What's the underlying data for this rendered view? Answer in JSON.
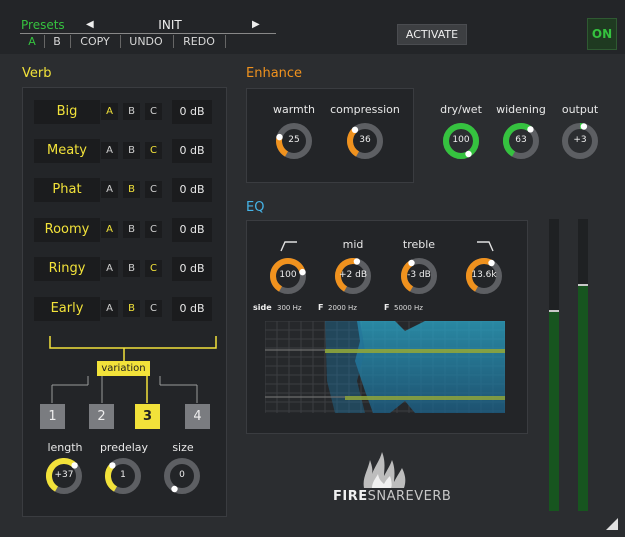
{
  "presets": {
    "title": "Presets",
    "name": "INIT",
    "prev_icon": "triangle-left-icon",
    "next_icon": "triangle-right-icon",
    "buttons": [
      "A",
      "B",
      "COPY",
      "UNDO",
      "REDO"
    ]
  },
  "activate": "ACTIVATE",
  "power": "ON",
  "verb": {
    "title": "Verb",
    "rows": [
      {
        "name": "Big",
        "sel": "A",
        "db": "0 dB"
      },
      {
        "name": "Meaty",
        "sel": "C",
        "db": "0 dB"
      },
      {
        "name": "Phat",
        "sel": "B",
        "db": "0 dB"
      },
      {
        "name": "Roomy",
        "sel": "A",
        "db": "0 dB"
      },
      {
        "name": "Ringy",
        "sel": "C",
        "db": "0 dB"
      },
      {
        "name": "Early",
        "sel": "B",
        "db": "0 dB"
      }
    ],
    "variation": "variation",
    "variation_numbers": [
      "1",
      "2",
      "3",
      "4"
    ],
    "selected_variation": "3",
    "knobs": [
      {
        "label": "length",
        "value": "+37",
        "fill": 0.65
      },
      {
        "label": "predelay",
        "value": "1",
        "fill": 0.35
      },
      {
        "label": "size",
        "value": "0",
        "fill": 0
      }
    ]
  },
  "enhance": {
    "title": "Enhance",
    "knobs": [
      {
        "label": "warmth",
        "value": "25",
        "fill": 0.25
      },
      {
        "label": "compression",
        "value": "36",
        "fill": 0.36
      }
    ]
  },
  "mix": [
    {
      "label": "dry/wet",
      "value": "100",
      "fill": 1.0
    },
    {
      "label": "widening",
      "value": "63",
      "fill": 0.63
    },
    {
      "label": "output",
      "value": "+3",
      "fill": 0.1
    }
  ],
  "eq": {
    "title": "EQ",
    "bands": [
      {
        "label": "",
        "icon": "highpass-icon",
        "value": "100",
        "fill": 0.75,
        "sub_prefix": "side",
        "sub": "300 Hz"
      },
      {
        "label": "mid",
        "icon": "",
        "value": "+2 dB",
        "fill": 0.55,
        "sub_prefix": "F",
        "sub": "2000 Hz"
      },
      {
        "label": "treble",
        "icon": "",
        "value": "-3 dB",
        "fill": 0.4,
        "sub_prefix": "F",
        "sub": "5000 Hz"
      },
      {
        "label": "",
        "icon": "lowpass-icon",
        "value": "13.6k",
        "fill": 0.6,
        "sub_prefix": "",
        "sub": ""
      }
    ]
  },
  "logo": {
    "bold": "FIRE",
    "light": "SNAREVERB"
  },
  "meters": [
    {
      "level": 0.68
    },
    {
      "level": 0.77
    }
  ],
  "colors": {
    "yellow": "#f2e23a",
    "orange": "#f0921e",
    "green": "#35c23f",
    "panel": "#232528"
  }
}
